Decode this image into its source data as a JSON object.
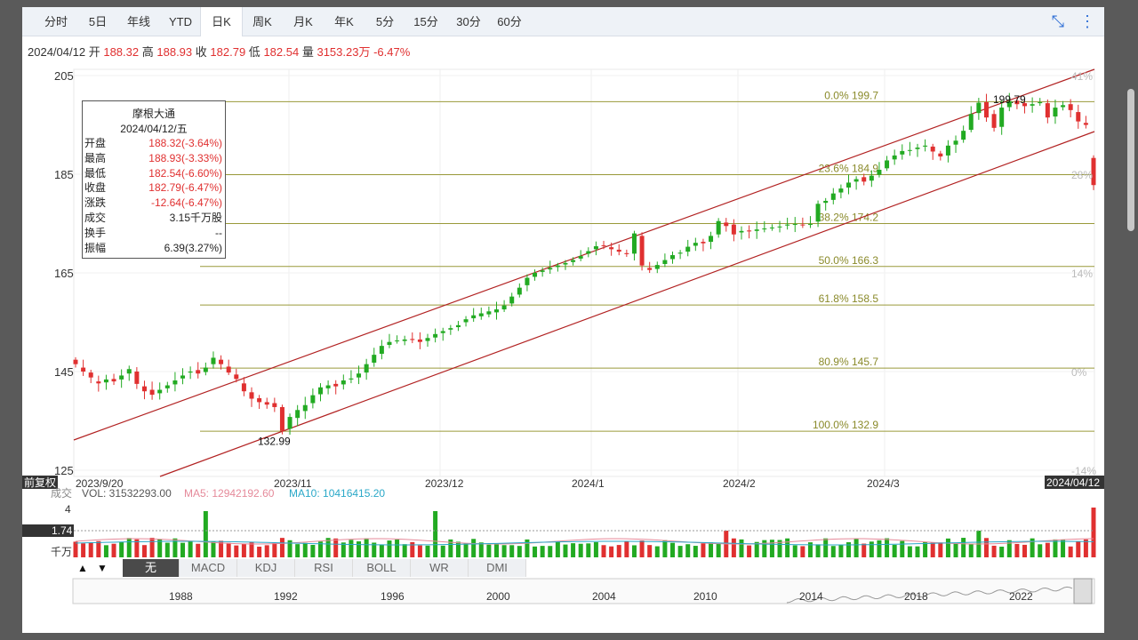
{
  "tabs": [
    "分时",
    "5日",
    "年线",
    "YTD",
    "日K",
    "周K",
    "月K",
    "年K",
    "5分",
    "15分",
    "30分",
    "60分"
  ],
  "active_tab": "日K",
  "toolbar_icons": [
    "compress-icon",
    "more-icon"
  ],
  "ohlc_line": {
    "date": "2024/04/12",
    "open_label": "开",
    "open": "188.32",
    "high_label": "高",
    "high": "188.93",
    "close_label": "收",
    "close": "182.79",
    "low_label": "低",
    "low": "182.54",
    "vol_label": "量",
    "vol": "3153.23万",
    "change": "-6.47%"
  },
  "info_box": {
    "title": "摩根大通",
    "date": "2024/04/12/五",
    "rows": [
      {
        "k": "开盘",
        "v": "188.32(-3.64%)",
        "red": true
      },
      {
        "k": "最高",
        "v": "188.93(-3.33%)",
        "red": true
      },
      {
        "k": "最低",
        "v": "182.54(-6.60%)",
        "red": true
      },
      {
        "k": "收盘",
        "v": "182.79(-6.47%)",
        "red": true
      },
      {
        "k": "涨跌",
        "v": "-12.64(-6.47%)",
        "red": true
      },
      {
        "k": "成交",
        "v": "3.15千万股",
        "red": false
      },
      {
        "k": "换手",
        "v": "--",
        "red": false
      },
      {
        "k": "振幅",
        "v": "6.39(3.27%)",
        "red": false
      }
    ]
  },
  "adjust_label": "前复权",
  "last_date_label": "2024/04/12",
  "volume_header": {
    "label": "成交",
    "vol": "VOL: 31532293.00",
    "ma5": "MA5: 12942192.60",
    "ma10": "MA10: 10416415.20"
  },
  "volume_axis": {
    "top": "4",
    "mid": "1.74",
    "unit": "千万"
  },
  "indicator_arrows": [
    "▲",
    "▼"
  ],
  "indicators": [
    "无",
    "MACD",
    "KDJ",
    "RSI",
    "BOLL",
    "WR",
    "DMI"
  ],
  "active_indicator": "无",
  "timeline_years": [
    "1988",
    "1992",
    "1996",
    "2000",
    "2004",
    "2010",
    "2014",
    "2018",
    "2022"
  ],
  "colors": {
    "up": "#22aa22",
    "down": "#e03030",
    "fib": "#8a8a2a",
    "channel": "#b22222",
    "ma5": "#e58a9a",
    "ma10": "#2aa8c8"
  },
  "chart_data": {
    "type": "candlestick",
    "ylim": [
      125,
      205
    ],
    "y_ticks": [
      125,
      145,
      165,
      185,
      205
    ],
    "pct_ticks": [
      "41%",
      "28%",
      "14%",
      "0%",
      "-14%"
    ],
    "x_tick_labels": [
      "2023/9/20",
      "2023/11",
      "2023/12",
      "2024/1",
      "2024/2",
      "2024/3"
    ],
    "annotations": [
      {
        "text": "199.79",
        "value": 199.79
      },
      {
        "text": "132.99",
        "value": 132.99
      }
    ],
    "fib_levels": [
      {
        "label": "0.0% 199.7",
        "value": 199.7
      },
      {
        "label": "23.6% 184.9",
        "value": 184.9
      },
      {
        "label": "38.2% 174.2",
        "value": 175.0
      },
      {
        "label": "50.0% 166.3",
        "value": 166.3
      },
      {
        "label": "61.8% 158.5",
        "value": 158.5
      },
      {
        "label": "80.9% 145.7",
        "value": 145.7
      },
      {
        "label": "100.0% 132.9",
        "value": 132.9
      }
    ],
    "closes": [
      146.5,
      145.0,
      143.8,
      142.6,
      143.4,
      143.0,
      144.2,
      145.5,
      142.5,
      141.0,
      140.3,
      141.3,
      142.2,
      143.2,
      144.2,
      145.0,
      144.6,
      145.8,
      147.8,
      146.5,
      144.8,
      143.5,
      141.0,
      139.5,
      138.8,
      138.3,
      137.8,
      133.0,
      135.8,
      137.2,
      138.2,
      140.2,
      141.8,
      142.2,
      142.0,
      143.2,
      143.6,
      144.6,
      146.5,
      148.4,
      150.2,
      151.0,
      151.3,
      151.5,
      151.4,
      151.0,
      151.8,
      152.6,
      153.2,
      153.8,
      154.4,
      155.6,
      156.4,
      156.8,
      157.2,
      157.6,
      158.4,
      160.2,
      162.0,
      164.0,
      165.0,
      165.5,
      166.0,
      166.5,
      167.0,
      167.6,
      168.4,
      169.4,
      170.4,
      170.5,
      169.8,
      169.3,
      168.8,
      173.0,
      166.5,
      165.6,
      166.6,
      167.6,
      168.6,
      169.1,
      170.3,
      171.1,
      171.0,
      172.5,
      175.5,
      174.5,
      172.8,
      173.5,
      173.4,
      173.8,
      174.0,
      174.2,
      174.4,
      174.8,
      174.9,
      174.7,
      174.9,
      179.0,
      179.6,
      181.1,
      182.1,
      183.3,
      184.0,
      183.5,
      184.7,
      185.9,
      187.8,
      188.8,
      189.7,
      189.9,
      190.4,
      190.8,
      189.6,
      188.6,
      190.8,
      191.8,
      193.8,
      197.2,
      199.5,
      196.5,
      194.4,
      198.5,
      199.8,
      199.2,
      198.8,
      199.2,
      199.6,
      196.5,
      198.5,
      199.0,
      198.0,
      195.7,
      195.0,
      182.8
    ],
    "opens": [
      147.4,
      145.8,
      144.8,
      143.0,
      142.8,
      143.5,
      143.4,
      144.6,
      145.0,
      142.0,
      141.3,
      140.6,
      141.6,
      142.4,
      143.6,
      144.8,
      145.3,
      144.9,
      146.5,
      147.4,
      146.0,
      144.4,
      142.6,
      140.8,
      139.6,
      138.8,
      138.6,
      137.8,
      133.4,
      135.6,
      137.0,
      138.6,
      140.4,
      141.6,
      142.5,
      142.4,
      143.4,
      143.8,
      144.8,
      146.8,
      148.6,
      150.4,
      151.3,
      151.2,
      151.6,
      151.5,
      151.2,
      151.9,
      152.8,
      153.5,
      154.0,
      155.0,
      155.8,
      156.2,
      156.6,
      157.0,
      157.6,
      158.8,
      160.6,
      162.5,
      164.2,
      165.2,
      165.7,
      166.2,
      166.7,
      167.2,
      167.9,
      168.9,
      169.8,
      170.6,
      170.2,
      169.7,
      169.0,
      168.9,
      172.5,
      166.0,
      165.8,
      166.8,
      167.8,
      168.9,
      169.3,
      170.5,
      171.3,
      171.3,
      172.8,
      175.2,
      174.8,
      173.2,
      173.6,
      173.5,
      173.9,
      174.1,
      174.3,
      174.6,
      174.9,
      174.8,
      174.8,
      175.4,
      179.2,
      179.8,
      181.3,
      182.3,
      183.5,
      184.4,
      183.7,
      184.9,
      186.2,
      188.0,
      189.0,
      189.8,
      190.1,
      190.6,
      190.6,
      189.2,
      188.8,
      191.0,
      192.0,
      194.0,
      197.4,
      199.6,
      197.2,
      194.6,
      198.6,
      199.9,
      199.4,
      198.9,
      199.4,
      199.4,
      196.7,
      198.6,
      199.2,
      197.6,
      195.4,
      188.3
    ]
  }
}
